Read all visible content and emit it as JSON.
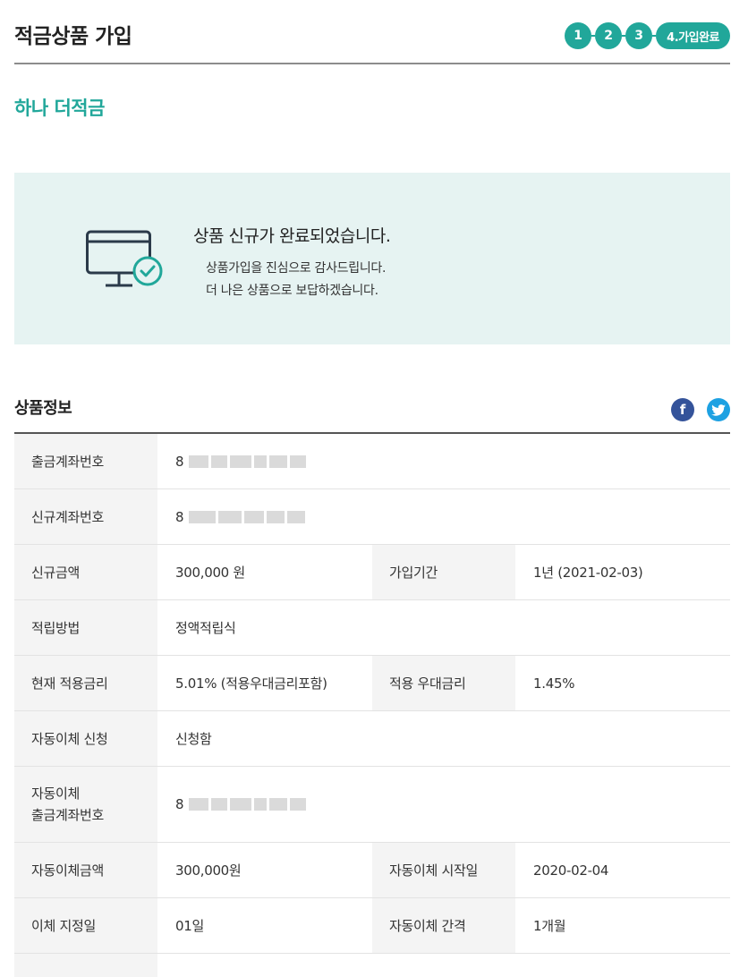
{
  "header": {
    "title": "적금상품 가입",
    "steps": [
      "1",
      "2",
      "3",
      "4.가입완료"
    ]
  },
  "product": {
    "name": "하나 더적금"
  },
  "completion": {
    "title": "상품 신규가 완료되었습니다.",
    "message_line1": "상품가입을 진심으로 감사드립니다.",
    "message_line2": "더 나은 상품으로 보답하겠습니다."
  },
  "section": {
    "title": "상품정보"
  },
  "share": {
    "facebook": "f"
  },
  "info": {
    "withdraw_account_label": "출금계좌번호",
    "withdraw_account_value": "8",
    "new_account_label": "신규계좌번호",
    "new_account_value": "8",
    "amount_label": "신규금액",
    "amount_value": "300,000 원",
    "period_label": "가입기간",
    "period_value": "1년 (2021-02-03)",
    "method_label": "적립방법",
    "method_value": "정액적립식",
    "rate_label": "현재 적용금리",
    "rate_value": "5.01% (적용우대금리포함)",
    "pref_rate_label": "적용 우대금리",
    "pref_rate_value": "1.45%",
    "auto_apply_label": "자동이체 신청",
    "auto_apply_value": "신청함",
    "auto_account_label_line1": "자동이체",
    "auto_account_label_line2": "출금계좌번호",
    "auto_account_value": "8",
    "auto_amount_label": "자동이체금액",
    "auto_amount_value": "300,000원",
    "auto_start_label": "자동이체 시작일",
    "auto_start_value": "2020-02-04",
    "transfer_day_label": "이체 지정일",
    "transfer_day_value": "01일",
    "transfer_interval_label": "자동이체 간격",
    "transfer_interval_value": "1개월"
  },
  "colors": {
    "accent": "#21a79a",
    "panel_bg": "#e6f3f2",
    "facebook": "#34539a",
    "twitter": "#1da1e2"
  }
}
